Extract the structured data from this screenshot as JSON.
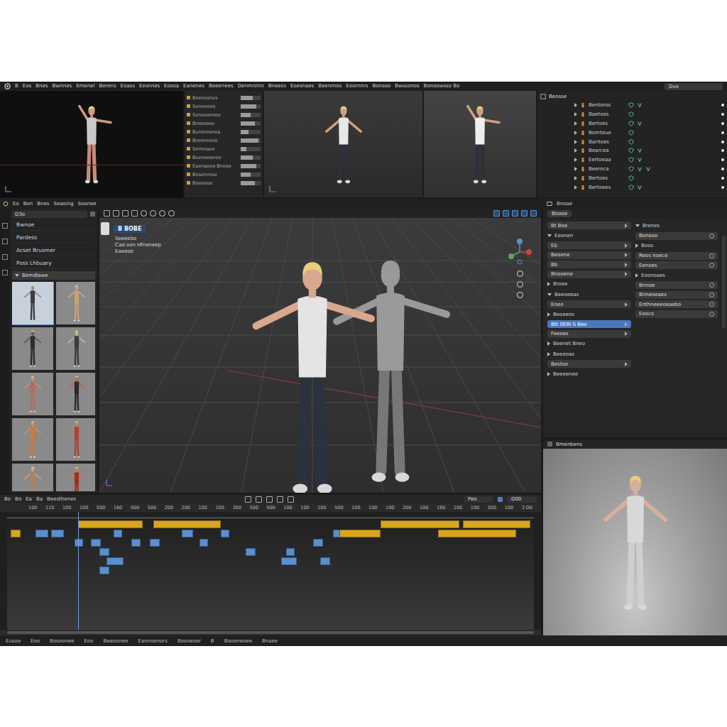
{
  "menu_bar": {
    "items": [
      "B",
      "Eos",
      "Bnes",
      "Bwrines",
      "Emenel",
      "Berens",
      "Eoass",
      "Eesnnes",
      "Eoosa",
      "Eanenes",
      "Beeeriees",
      "Denmnrnn",
      "Bneess",
      "Eoesnaes",
      "Beenrnos",
      "Eoornnrs",
      "Bonsoo",
      "Bwssonos",
      "Bonoowsso Bo"
    ],
    "search": "Dvo"
  },
  "top_list": {
    "rows": [
      {
        "name": "Bnenosnes",
        "level": 0.6
      },
      {
        "name": "Sennneee",
        "level": 0.8
      },
      {
        "name": "Senesonnee",
        "level": 0.5
      },
      {
        "name": "Breonoee",
        "level": 0.7
      },
      {
        "name": "Buroneonea",
        "level": 0.4
      },
      {
        "name": "Brenneeno",
        "level": 0.9
      },
      {
        "name": "Srrmnaee",
        "level": 0.3
      },
      {
        "name": "Beenoeonee",
        "level": 0.6
      },
      {
        "name": "Eaenaoeo Bneoe",
        "level": 0.8
      },
      {
        "name": "Besenrnee",
        "level": 0.5
      },
      {
        "name": "Boeeooe",
        "level": 0.7
      }
    ]
  },
  "outliner": {
    "title": "Beosse",
    "rows": [
      {
        "name": "Bentoros",
        "links": 1,
        "visible": true
      },
      {
        "name": "Baetoes",
        "links": 0,
        "visible": true
      },
      {
        "name": "Bertoes",
        "links": 1,
        "visible": true
      },
      {
        "name": "Bomteue",
        "links": 0,
        "visible": true
      },
      {
        "name": "Baritoes",
        "links": 0,
        "visible": true
      },
      {
        "name": "Bearcea",
        "links": 1,
        "visible": true
      },
      {
        "name": "Eertoeaa",
        "links": 1,
        "visible": true
      },
      {
        "name": "Beeroca",
        "links": 2,
        "visible": true
      },
      {
        "name": "Bertoes",
        "links": 0,
        "visible": true
      },
      {
        "name": "Bertoees",
        "links": 1,
        "visible": true
      }
    ]
  },
  "workspace_bar": {
    "items": [
      "Eo",
      "Bon",
      "Bnes",
      "Seaoing",
      "Soonee"
    ],
    "right": "Bnoae"
  },
  "asset_browser": {
    "field": "D3o",
    "items": [
      {
        "label": "Bwnoe",
        "selected": false
      },
      {
        "label": "Pardess",
        "selected": false
      },
      {
        "label": "Acset Brusmer",
        "selected": false
      },
      {
        "label": "Poss Lhbuary",
        "selected": false
      }
    ],
    "section": "Bemdlawe",
    "thumbnails": [
      {
        "color": "#3b4046",
        "skin": "#9c8576",
        "selected": true
      },
      {
        "color": "#c8a070",
        "skin": "#d4a080",
        "selected": false
      },
      {
        "color": "#2e2e30",
        "skin": "#6a5548",
        "selected": false
      },
      {
        "color": "#3c3c40",
        "skin": "#d0b090",
        "selected": false
      },
      {
        "color": "#b07060",
        "skin": "#c89080",
        "selected": false
      },
      {
        "color": "#2a2a2a",
        "skin": "#b07050",
        "selected": false
      },
      {
        "color": "#c87a40",
        "skin": "#c89070",
        "selected": false
      },
      {
        "color": "#b04030",
        "skin": "#c08060",
        "selected": false
      },
      {
        "color": "#b08060",
        "skin": "#d0a080",
        "selected": false
      },
      {
        "color": "#a03020",
        "skin": "#c08060",
        "selected": false
      }
    ]
  },
  "viewport": {
    "mode": "B BOBE",
    "overlay": [
      "Seeeebo",
      "Cad oon Hfneneep",
      "Eaeeoo"
    ]
  },
  "properties": {
    "title": "Boooe",
    "left": [
      {
        "kind": "field",
        "label": "Bt Boe",
        "selected": false
      },
      {
        "kind": "section",
        "label": "Eeonen",
        "expanded": true
      },
      {
        "kind": "field",
        "label": "Eb",
        "selected": false
      },
      {
        "kind": "field",
        "label": "Beoene",
        "selected": false
      },
      {
        "kind": "field",
        "label": "Bb",
        "selected": false
      },
      {
        "kind": "field",
        "label": "Bnooene",
        "selected": false
      },
      {
        "kind": "section",
        "label": "Broee",
        "expanded": false
      },
      {
        "kind": "section",
        "label": "Beeoeeas",
        "expanded": true
      },
      {
        "kind": "field",
        "label": "Eneo",
        "selected": false
      },
      {
        "kind": "section",
        "label": "Beoeeos",
        "expanded": false
      },
      {
        "kind": "field",
        "label": "Btt 0ERI S Beo",
        "selected": true
      },
      {
        "kind": "field",
        "label": "Feeoes",
        "selected": false
      },
      {
        "kind": "section",
        "label": "Beenet Bneo",
        "expanded": false
      },
      {
        "kind": "section",
        "label": "Beeeoas",
        "expanded": false
      },
      {
        "kind": "field",
        "label": "Bestoo",
        "selected": false
      },
      {
        "kind": "section",
        "label": "Beeeenee",
        "expanded": false
      }
    ],
    "right": [
      {
        "kind": "section",
        "label": "Brenes",
        "expanded": true
      },
      {
        "kind": "field",
        "label": "Boneoo",
        "selected": false
      },
      {
        "kind": "section",
        "label": "Boso",
        "expanded": false
      },
      {
        "kind": "field",
        "label": "Reos noece",
        "selected": false
      },
      {
        "kind": "field",
        "label": "Eenoes",
        "selected": false
      },
      {
        "kind": "section",
        "label": "Eoonoaes",
        "expanded": false
      },
      {
        "kind": "field",
        "label": "Bnnoe",
        "selected": false
      },
      {
        "kind": "field",
        "label": "Bnneoeaes",
        "selected": false
      },
      {
        "kind": "field",
        "label": "Enthneeeoeaebo",
        "selected": false
      },
      {
        "kind": "field",
        "label": "Eeoco",
        "selected": false
      }
    ]
  },
  "preview": {
    "title": "Bmenbens"
  },
  "timeline": {
    "tabs": [
      "Bo",
      "Bo",
      "Ea",
      "Ba",
      "Beesthenes"
    ],
    "frame_field": "Peo",
    "end_field": "D00",
    "ruler": [
      "100",
      "110",
      "100",
      "100",
      "500",
      "160",
      "500",
      "500",
      "200",
      "200",
      "100",
      "100",
      "300",
      "500",
      "500",
      "100",
      "100",
      "100",
      "500",
      "100",
      "100",
      "100",
      "200",
      "100",
      "180",
      "100",
      "100",
      "500",
      "100",
      "3 D0"
    ],
    "playhead": 100,
    "keys": [
      {
        "track": 1,
        "frame": 5,
        "length": 14,
        "color": "#d9a520"
      },
      {
        "track": 0,
        "frame": 100,
        "length": 90,
        "color": "#d9a520"
      },
      {
        "track": 0,
        "frame": 205,
        "length": 95,
        "color": "#d9a520"
      },
      {
        "track": 1,
        "frame": 465,
        "length": 60,
        "color": "#d9a520"
      },
      {
        "track": 0,
        "frame": 525,
        "length": 110,
        "color": "#d9a520"
      },
      {
        "track": 0,
        "frame": 640,
        "length": 95,
        "color": "#d9a520"
      },
      {
        "track": 1,
        "frame": 605,
        "length": 110,
        "color": "#d9a520"
      },
      {
        "track": 1,
        "frame": 40,
        "length": 18,
        "color": "#5a8fcf"
      },
      {
        "track": 1,
        "frame": 62,
        "length": 18,
        "color": "#5a8fcf"
      },
      {
        "track": 2,
        "frame": 95,
        "length": 12,
        "color": "#5a8fcf"
      },
      {
        "track": 2,
        "frame": 118,
        "length": 14,
        "color": "#5a8fcf"
      },
      {
        "track": 1,
        "frame": 150,
        "length": 12,
        "color": "#5a8fcf"
      },
      {
        "track": 2,
        "frame": 175,
        "length": 12,
        "color": "#5a8fcf"
      },
      {
        "track": 3,
        "frame": 130,
        "length": 14,
        "color": "#5a8fcf"
      },
      {
        "track": 4,
        "frame": 140,
        "length": 24,
        "color": "#5a8fcf"
      },
      {
        "track": 5,
        "frame": 130,
        "length": 14,
        "color": "#5a8fcf"
      },
      {
        "track": 2,
        "frame": 200,
        "length": 14,
        "color": "#5a8fcf"
      },
      {
        "track": 1,
        "frame": 245,
        "length": 16,
        "color": "#5a8fcf"
      },
      {
        "track": 2,
        "frame": 270,
        "length": 12,
        "color": "#5a8fcf"
      },
      {
        "track": 1,
        "frame": 300,
        "length": 12,
        "color": "#5a8fcf"
      },
      {
        "track": 3,
        "frame": 335,
        "length": 14,
        "color": "#5a8fcf"
      },
      {
        "track": 4,
        "frame": 385,
        "length": 22,
        "color": "#5a8fcf"
      },
      {
        "track": 3,
        "frame": 392,
        "length": 12,
        "color": "#5a8fcf"
      },
      {
        "track": 2,
        "frame": 430,
        "length": 14,
        "color": "#5a8fcf"
      },
      {
        "track": 1,
        "frame": 458,
        "length": 10,
        "color": "#5a8fcf"
      },
      {
        "track": 4,
        "frame": 440,
        "length": 14,
        "color": "#5a8fcf"
      }
    ]
  },
  "status_bar": [
    "Eusoo",
    "Eoo",
    "Bosoonee",
    "Eoo",
    "Beeoonee",
    "Eannoenors",
    "Bosneoer",
    "B",
    "Boooneoee",
    "Bnaee"
  ]
}
